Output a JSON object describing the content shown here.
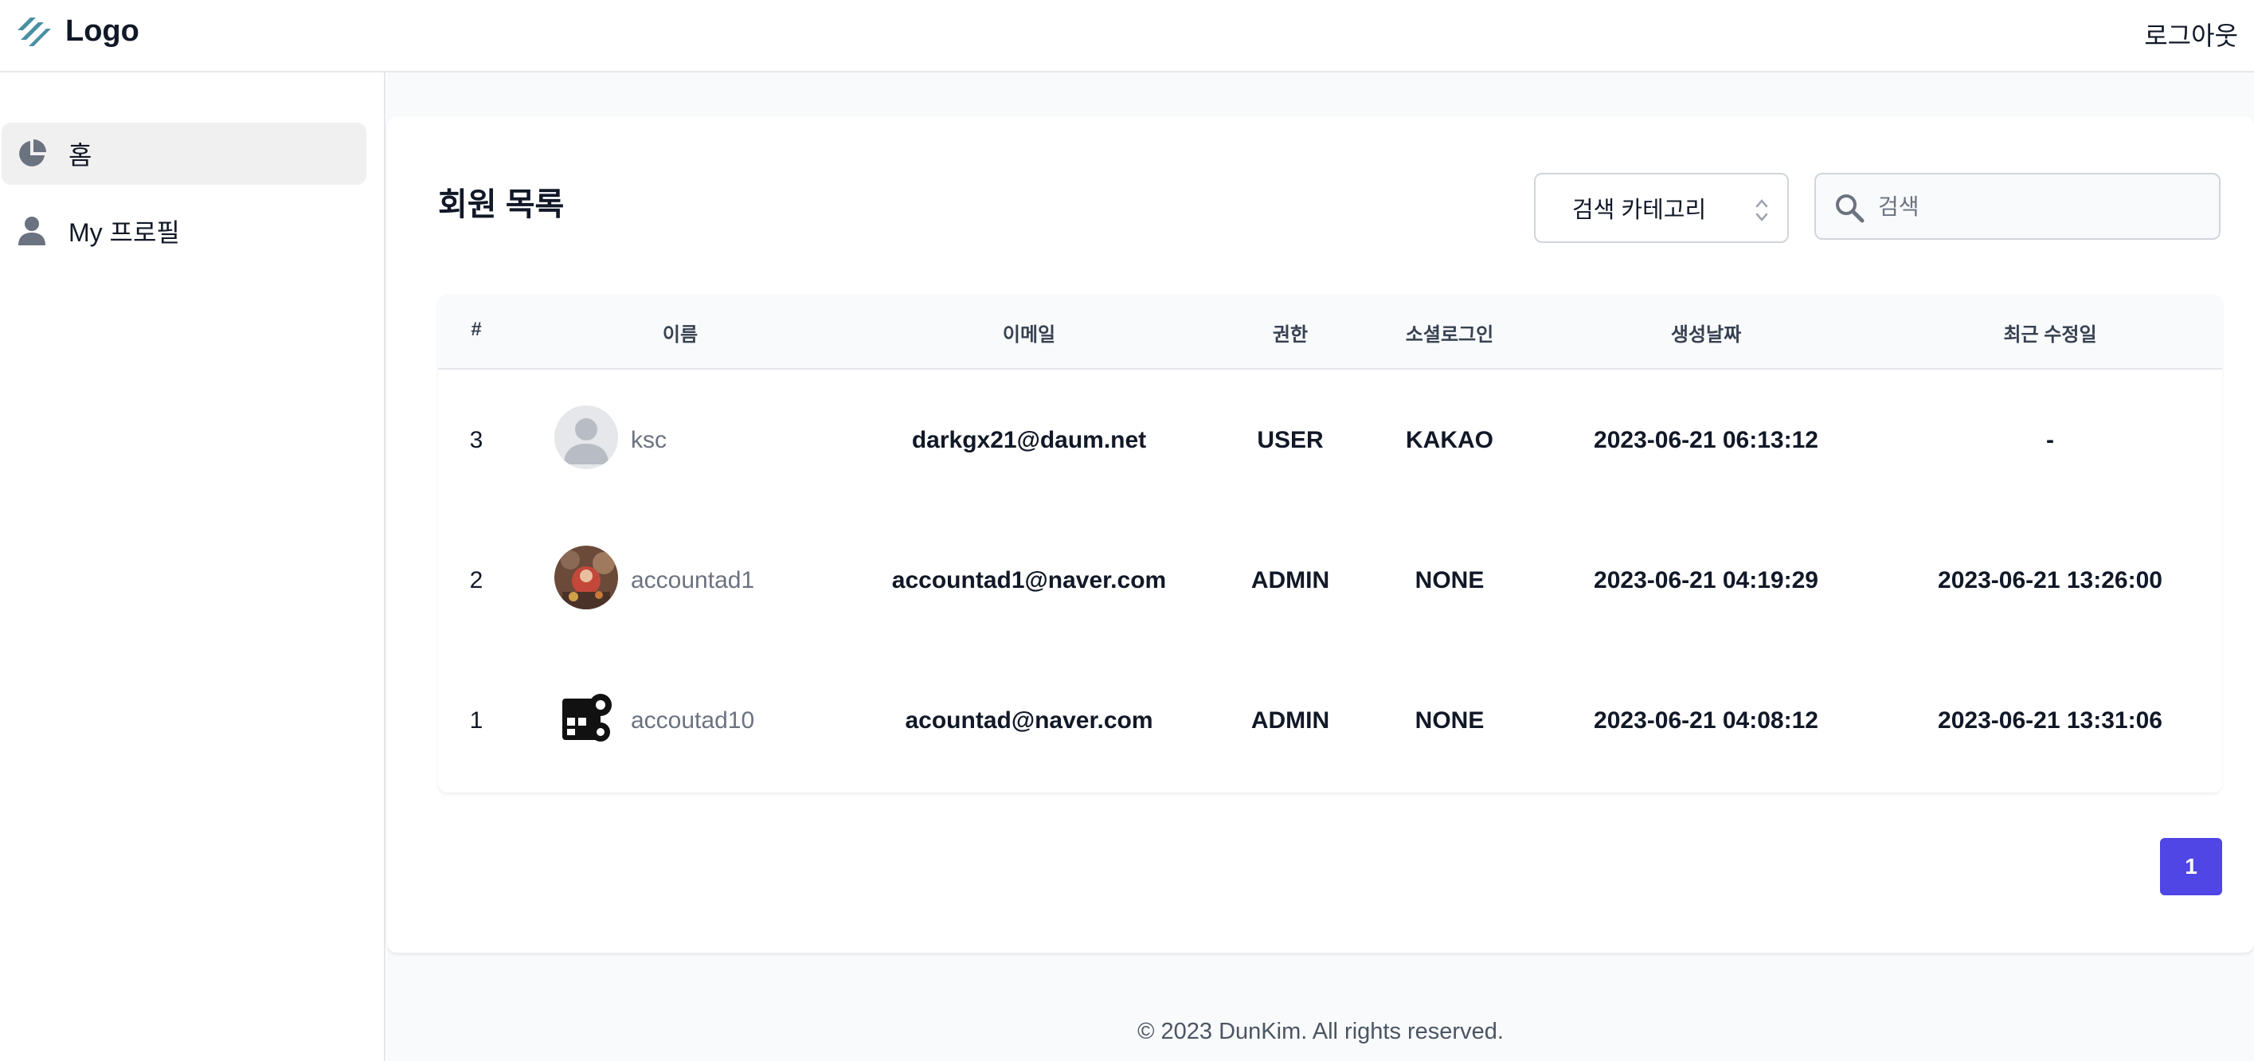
{
  "header": {
    "logo_text": "Logo",
    "logout_label": "로그아웃"
  },
  "sidebar": {
    "items": [
      {
        "label": "홈",
        "icon": "pie-chart-icon",
        "active": true
      },
      {
        "label": "My 프로필",
        "icon": "user-icon",
        "active": false
      }
    ]
  },
  "main": {
    "title": "회원 목록",
    "category_select": {
      "selected": "검색 카테고리"
    },
    "search": {
      "placeholder": "검색",
      "value": ""
    },
    "table": {
      "columns": [
        "#",
        "이름",
        "이메일",
        "권한",
        "소셜로그인",
        "생성날짜",
        "최근 수정일"
      ],
      "rows": [
        {
          "id": "3",
          "name": "ksc",
          "avatar": "default-avatar-icon",
          "email": "darkgx21@daum.net",
          "role": "USER",
          "social": "KAKAO",
          "created": "2023-06-21 06:13:12",
          "modified": "-"
        },
        {
          "id": "2",
          "name": "accountad1",
          "avatar": "photo-avatar",
          "email": "accountad1@naver.com",
          "role": "ADMIN",
          "social": "NONE",
          "created": "2023-06-21 04:19:29",
          "modified": "2023-06-21 13:26:00"
        },
        {
          "id": "1",
          "name": "accoutad10",
          "avatar": "gear-board-icon",
          "email": "acountad@naver.com",
          "role": "ADMIN",
          "social": "NONE",
          "created": "2023-06-21 04:08:12",
          "modified": "2023-06-21 13:31:06"
        }
      ]
    },
    "pagination": {
      "current_page": "1"
    }
  },
  "footer": {
    "text": "© 2023 DunKim. All rights reserved."
  },
  "colors": {
    "accent": "#4f46e5",
    "logo": "#4a8fa3",
    "active_nav": "#f0f0f0"
  }
}
